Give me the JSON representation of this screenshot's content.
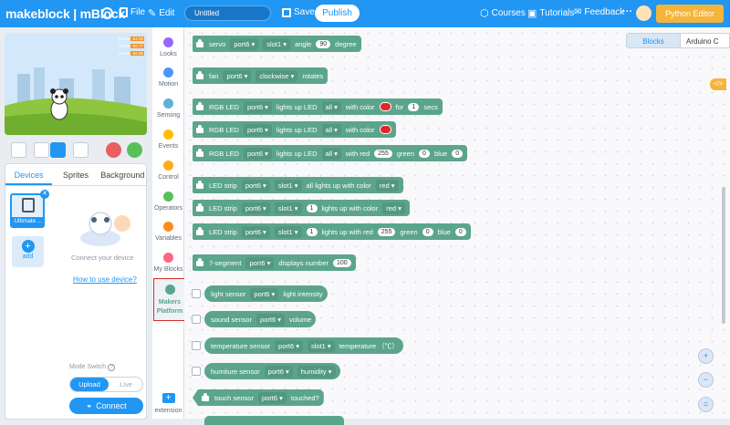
{
  "topbar": {
    "brand": "makeblock | mBlock",
    "file": "File",
    "edit": "Edit",
    "project_name": "Untitled",
    "save": "Save",
    "publish": "Publish",
    "courses": "Courses",
    "tutorials": "Tutorials",
    "feedback": "Feedback",
    "more": "···",
    "python_editor": "Python Editor"
  },
  "stage": {
    "x_axis_label": "X-axis",
    "x_axis_value": "-54.00",
    "y_axis_label": "Y-axis",
    "y_axis_value": "-86.77",
    "z_axis_label": "Z-axis",
    "z_axis_value": "-56.00"
  },
  "left_tabs": [
    "Devices",
    "Sprites",
    "Background"
  ],
  "devices": {
    "device_name": "Ultimate ...",
    "add_label": "add",
    "connect_hint": "Connect your device",
    "how_to_link": "How to use device?",
    "mode_switch_label": "Mode Switch",
    "upload_label": "Upload",
    "live_label": "Live",
    "connect_button": "Connect"
  },
  "categories": [
    "Looks",
    "Motion",
    "Sensing",
    "Events",
    "Control",
    "Operators",
    "Variables",
    "My Blocks",
    "Makers Platform",
    "extension"
  ],
  "category_colors": [
    "#9966ff",
    "#4c97ff",
    "#5cb1d6",
    "#ffbf00",
    "#ffab19",
    "#59c059",
    "#ff8c1a",
    "#ff6680",
    "#5ba58c"
  ],
  "right_tabs": {
    "blocks": "Blocks",
    "code": "Arduino C"
  },
  "blocks": {
    "servo": [
      "servo",
      "port6 ▾",
      "slot1 ▾",
      "angle",
      "90",
      "degree"
    ],
    "fan": [
      "fan",
      "port6 ▾",
      "clockwise ▾",
      "rotates"
    ],
    "rgb1": [
      "RGB LED",
      "port6 ▾",
      "lights up LED",
      "all ▾",
      "with color",
      "for",
      "1",
      "secs"
    ],
    "rgb2": [
      "RGB LED",
      "port6 ▾",
      "lights up LED",
      "all ▾",
      "with color"
    ],
    "rgb3": [
      "RGB LED",
      "port6 ▾",
      "lights up LED",
      "all ▾",
      "with red",
      "255",
      "green",
      "0",
      "blue",
      "0"
    ],
    "strip1": [
      "LED strip",
      "port6 ▾",
      "slot1 ▾",
      "all lights up with color",
      "red ▾"
    ],
    "strip2": [
      "LED strip",
      "port6 ▾",
      "slot1 ▾",
      "1",
      "lights up with color",
      "red ▾"
    ],
    "strip3": [
      "LED strip",
      "port6 ▾",
      "slot1 ▾",
      "1",
      "lights up with red",
      "255",
      "green",
      "0",
      "blue",
      "0"
    ],
    "seg": [
      "7-segment",
      "port6 ▾",
      "displays number",
      "100"
    ],
    "light": [
      "light sensor",
      "port6 ▾",
      "light intensity"
    ],
    "sound": [
      "sound sensor",
      "port6 ▾",
      "volume"
    ],
    "temp": [
      "temperature sensor",
      "port6 ▾",
      "slot1 ▾",
      "temperature （℃）"
    ],
    "humi": [
      "humiture sensor",
      "port6 ▾",
      "humidity ▾"
    ],
    "touch": [
      "touch sensor",
      "port6 ▾",
      "touched?"
    ]
  }
}
